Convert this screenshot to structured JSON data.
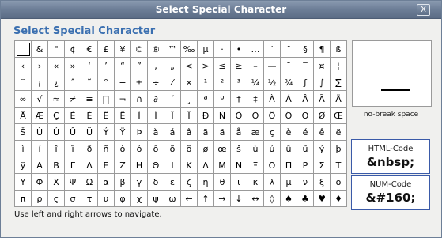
{
  "window": {
    "title": "Select Special Character",
    "close_label": "X"
  },
  "heading": "Select Special Character",
  "grid": {
    "rows": [
      [
        " ",
        "&",
        "\"",
        "¢",
        "€",
        "£",
        "¥",
        "©",
        "®",
        "™",
        "‰",
        "µ",
        "·",
        "•",
        "…",
        "′",
        "″",
        "§",
        "¶",
        "ß"
      ],
      [
        "‹",
        "›",
        "«",
        "»",
        "‘",
        "’",
        "“",
        "”",
        "‚",
        "„",
        "<",
        ">",
        "≤",
        "≥",
        "–",
        "—",
        "¯",
        "‾",
        "¤",
        "¦"
      ],
      [
        "¨",
        "¡",
        "¿",
        "ˆ",
        "˜",
        "°",
        "−",
        "±",
        "÷",
        "⁄",
        "×",
        "¹",
        "²",
        "³",
        "¼",
        "½",
        "¾",
        "ƒ",
        "∫",
        "∑"
      ],
      [
        "∞",
        "√",
        "≈",
        "≠",
        "≡",
        "∏",
        "¬",
        "∩",
        "∂",
        "´",
        "¸",
        "ª",
        "º",
        "†",
        "‡",
        "À",
        "Á",
        "Â",
        "Ã",
        "Ä"
      ],
      [
        "Å",
        "Æ",
        "Ç",
        "È",
        "É",
        "Ê",
        "Ë",
        "Ì",
        "Í",
        "Î",
        "Ï",
        "Ð",
        "Ñ",
        "Ò",
        "Ó",
        "Ô",
        "Õ",
        "Ö",
        "Ø",
        "Œ"
      ],
      [
        "Š",
        "Ù",
        "Ú",
        "Û",
        "Ü",
        "Ý",
        "Ÿ",
        "Þ",
        "à",
        "á",
        "â",
        "ã",
        "ä",
        "å",
        "æ",
        "ç",
        "è",
        "é",
        "ê",
        "ë"
      ],
      [
        "ì",
        "í",
        "î",
        "ï",
        "ð",
        "ñ",
        "ò",
        "ó",
        "ô",
        "õ",
        "ö",
        "ø",
        "œ",
        "š",
        "ù",
        "ú",
        "û",
        "ü",
        "ý",
        "þ"
      ],
      [
        "ÿ",
        "Α",
        "Β",
        "Γ",
        "Δ",
        "Ε",
        "Ζ",
        "Η",
        "Θ",
        "Ι",
        "Κ",
        "Λ",
        "Μ",
        "Ν",
        "Ξ",
        "Ο",
        "Π",
        "Ρ",
        "Σ",
        "Τ"
      ],
      [
        "Υ",
        "Φ",
        "Χ",
        "Ψ",
        "Ω",
        "α",
        "β",
        "γ",
        "δ",
        "ε",
        "ζ",
        "η",
        "θ",
        "ι",
        "κ",
        "λ",
        "μ",
        "ν",
        "ξ",
        "ο"
      ],
      [
        "π",
        "ρ",
        "ς",
        "σ",
        "τ",
        "υ",
        "φ",
        "χ",
        "ψ",
        "ω",
        "←",
        "↑",
        "→",
        "↓",
        "↔",
        "◊",
        "♠",
        "♣",
        "♥",
        "♦"
      ]
    ]
  },
  "preview": {
    "name": "no-break space"
  },
  "html_code": {
    "label": "HTML-Code",
    "value": "&nbsp;"
  },
  "num_code": {
    "label": "NUM-Code",
    "value": "&#160;"
  },
  "hint": "Use left and right arrows to navigate."
}
